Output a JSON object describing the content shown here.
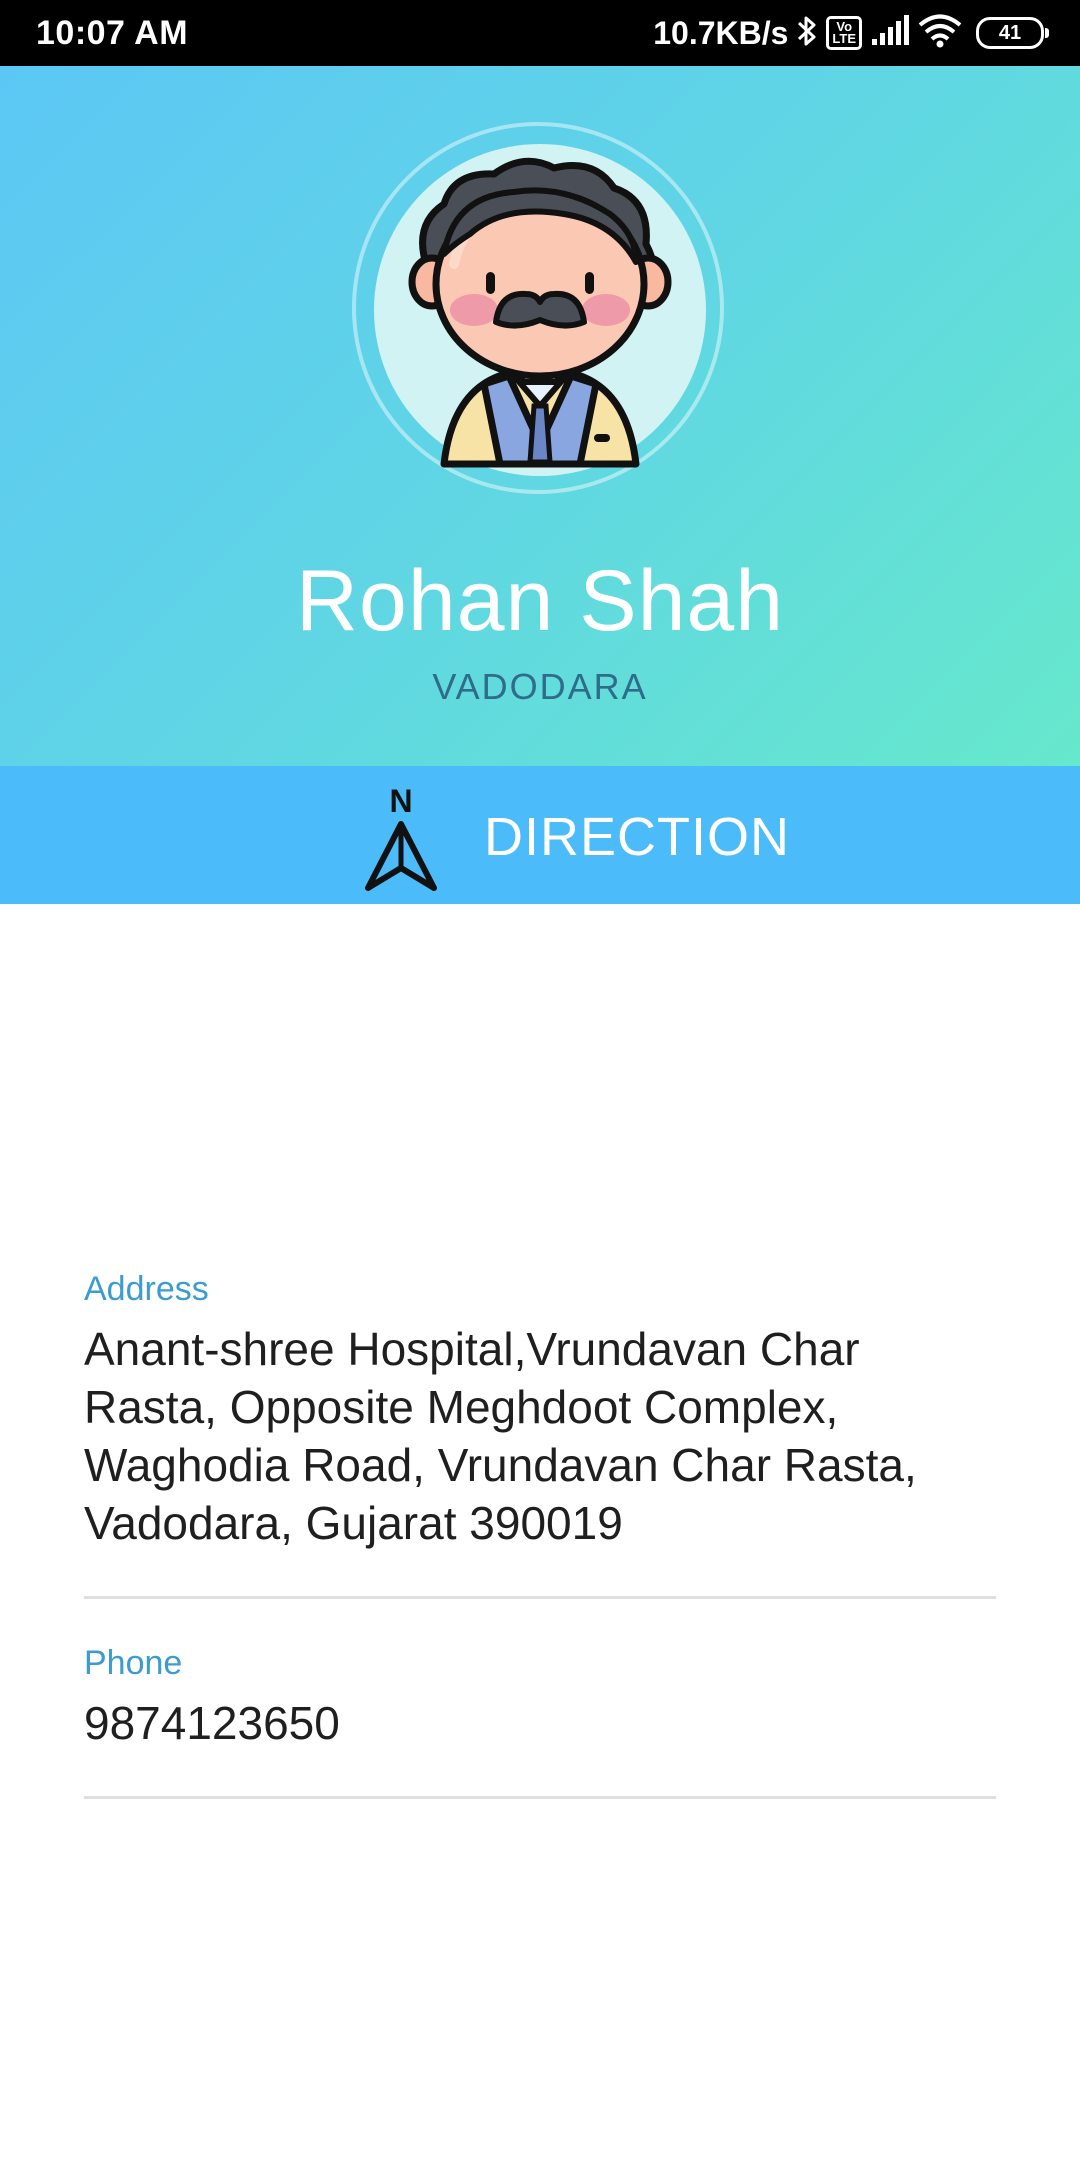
{
  "status_bar": {
    "time": "10:07 AM",
    "net_speed": "10.7KB/s",
    "volte_label": "Vo\nLTE",
    "battery_level": "41",
    "icons": [
      "bluetooth-icon",
      "volte-icon",
      "signal-icon",
      "wifi-icon",
      "battery-icon"
    ]
  },
  "profile": {
    "name": "Rohan Shah",
    "city": "VADODARA",
    "avatar_icon": "doctor-avatar-icon"
  },
  "direction": {
    "label": "DIRECTION",
    "north_letter": "N",
    "icon": "north-arrow-icon"
  },
  "details": {
    "address": {
      "label": "Address",
      "value": "Anant-shree Hospital,Vrundavan Char Rasta, Opposite Meghdoot Complex, Waghodia Road, Vrundavan Char Rasta, Vadodara, Gujarat 390019"
    },
    "phone": {
      "label": "Phone",
      "value": "9874123650"
    }
  },
  "colors": {
    "header_gradient_start": "#5cc7f5",
    "header_gradient_end": "#66e8cc",
    "direction_bar": "#4bbcf9",
    "label_accent": "#3c9bd0",
    "city_text": "#2f6c8a"
  }
}
